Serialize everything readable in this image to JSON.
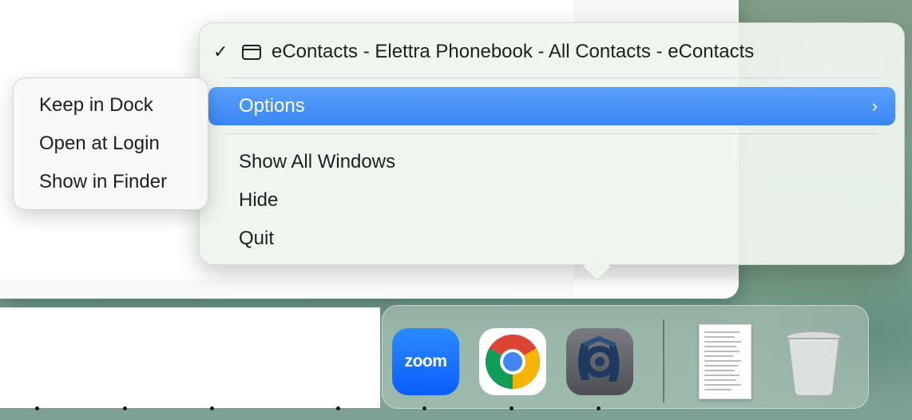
{
  "context_menu": {
    "window_item": {
      "checkmark": "✓",
      "label": "eContacts - Elettra Phonebook - All Contacts - eContacts"
    },
    "options": {
      "label": "Options",
      "chevron": "›"
    },
    "items": [
      {
        "label": "Show All Windows"
      },
      {
        "label": "Hide"
      },
      {
        "label": "Quit"
      }
    ]
  },
  "options_submenu": {
    "items": [
      {
        "label": "Keep in Dock"
      },
      {
        "label": "Open at Login"
      },
      {
        "label": "Show in Finder"
      }
    ]
  },
  "dock": {
    "apps": [
      {
        "name": "zoom-icon",
        "label": "zoom"
      },
      {
        "name": "chrome-icon"
      },
      {
        "name": "econtacts-icon"
      }
    ],
    "recent": {
      "name": "document-icon"
    },
    "trash": {
      "name": "trash-icon"
    }
  },
  "colors": {
    "highlight": "#3a86f4",
    "zoom": "#0b5cff"
  }
}
